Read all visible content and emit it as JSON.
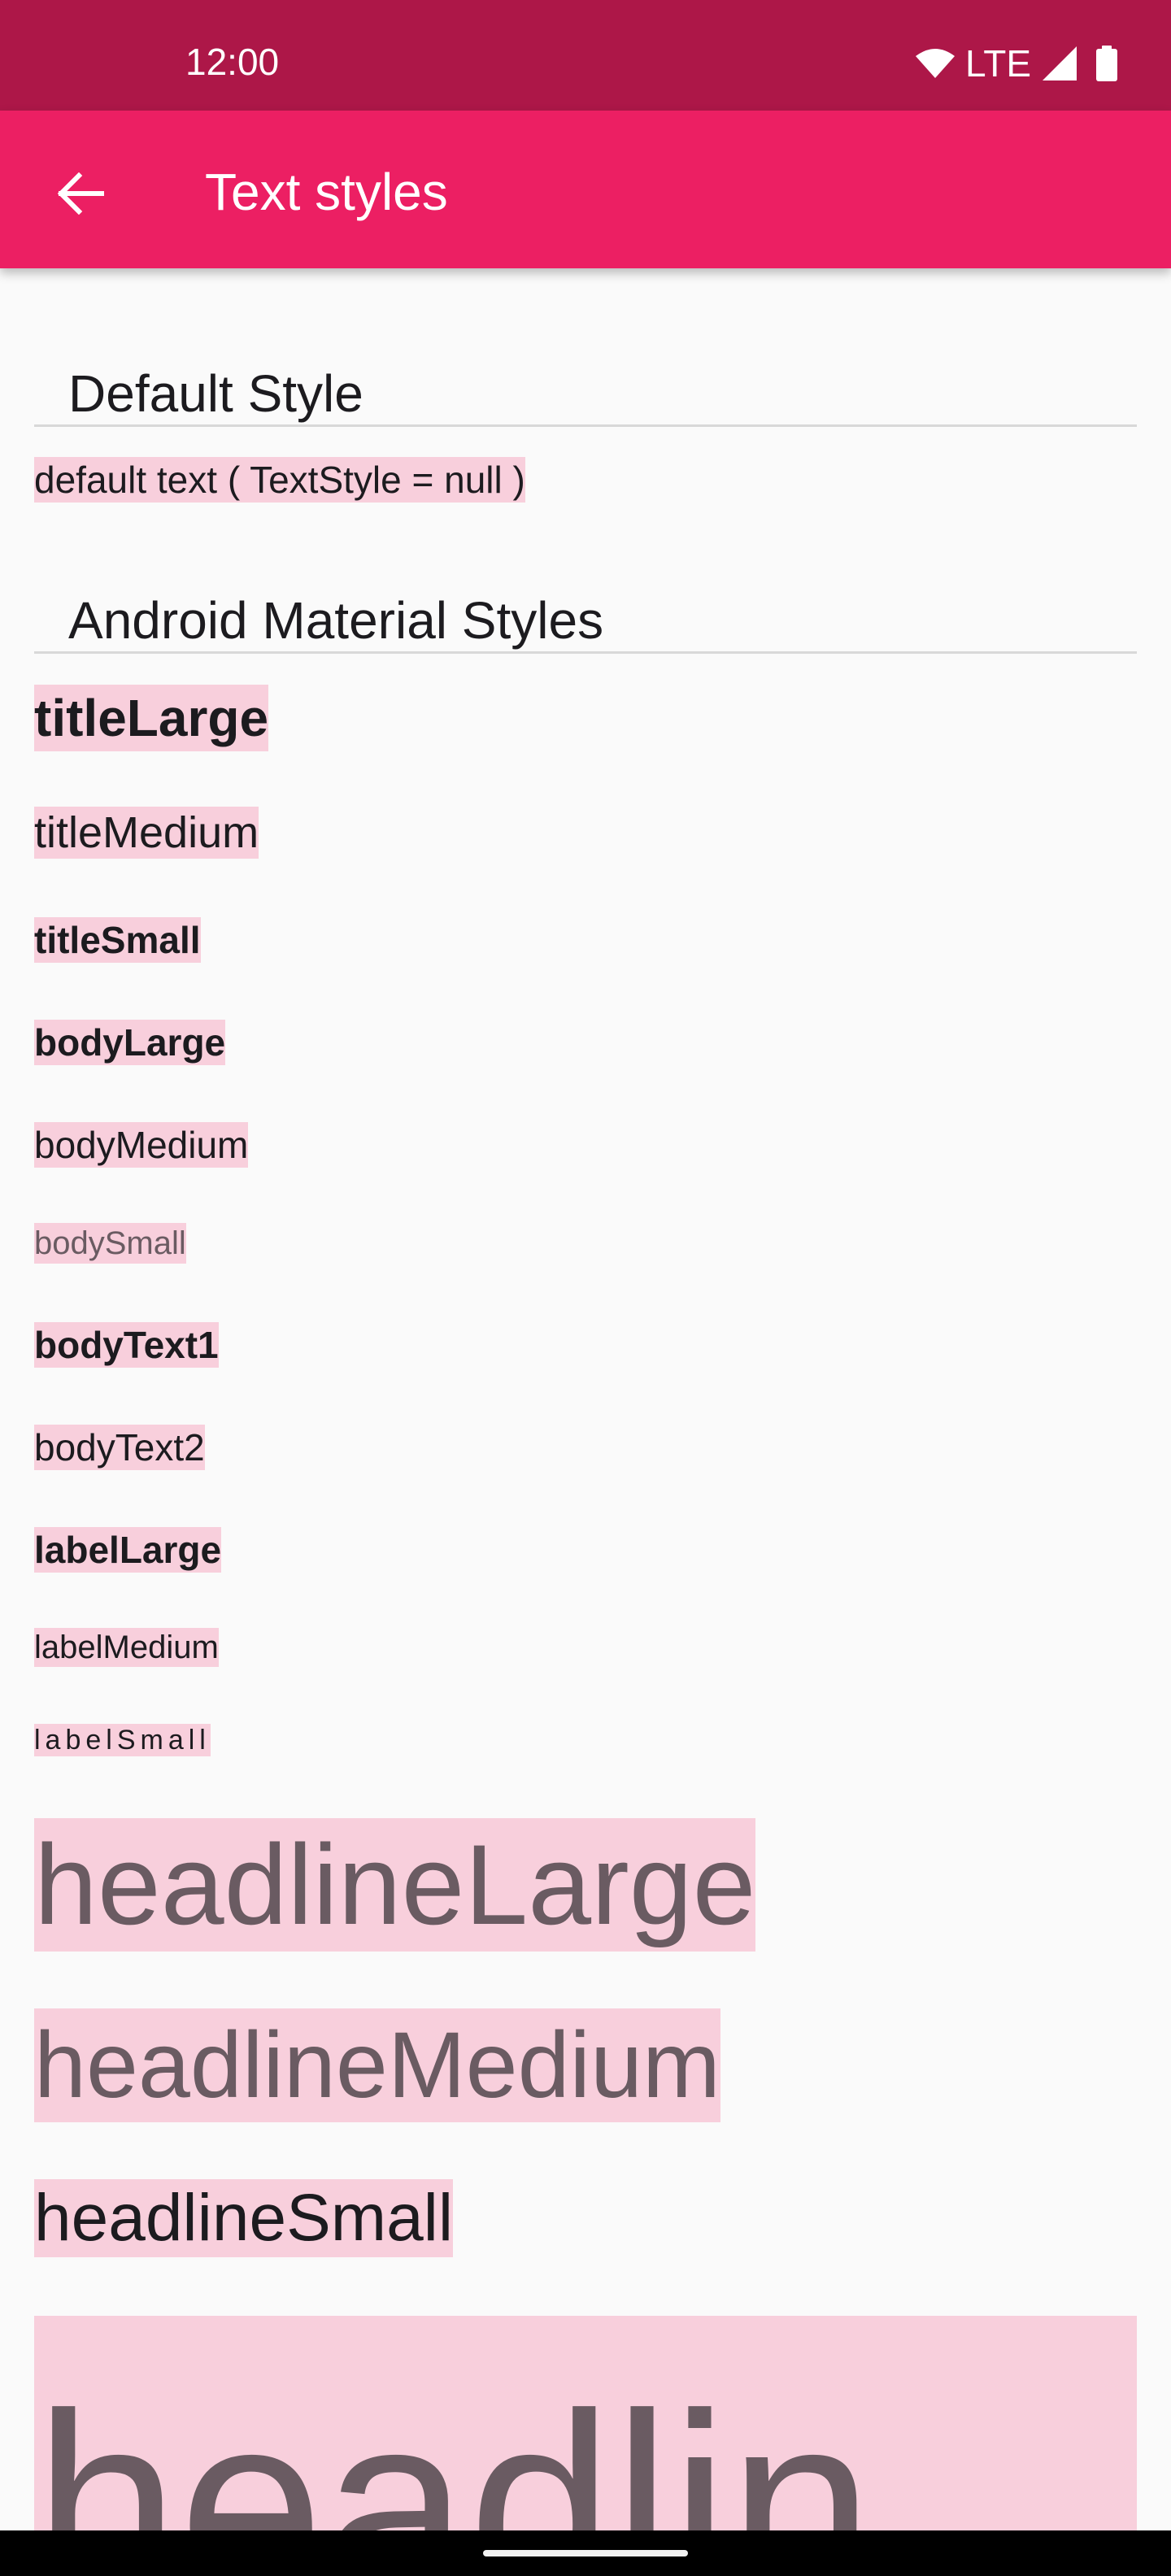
{
  "status_bar": {
    "time": "12:00",
    "network": "LTE",
    "icons": [
      "wifi-icon",
      "cell-signal-icon",
      "battery-icon"
    ]
  },
  "app_bar": {
    "back_icon": "arrow-back-icon",
    "title": "Text styles"
  },
  "sections": {
    "default_title": "Default Style",
    "default_sample": "default text ( TextStyle = null )",
    "material_title": "Android Material Styles"
  },
  "styles": {
    "title_large": "titleLarge",
    "title_medium": "titleMedium",
    "title_small": "titleSmall",
    "body_large": "bodyLarge",
    "body_medium": "bodyMedium",
    "body_small": "bodySmall",
    "body_text1": "bodyText1",
    "body_text2": "bodyText2",
    "label_large": "labelLarge",
    "label_medium": "labelMedium",
    "label_small": "labelSmall",
    "headline_large": "headlineLarge",
    "headline_medium": "headlineMedium",
    "headline_small": "headlineSmall",
    "display_partial": "headlin"
  },
  "colors": {
    "status_bar": "#ad1748",
    "app_bar": "#ec1f63",
    "sample_highlight": "#f8cfdc",
    "background": "#fafafa"
  }
}
